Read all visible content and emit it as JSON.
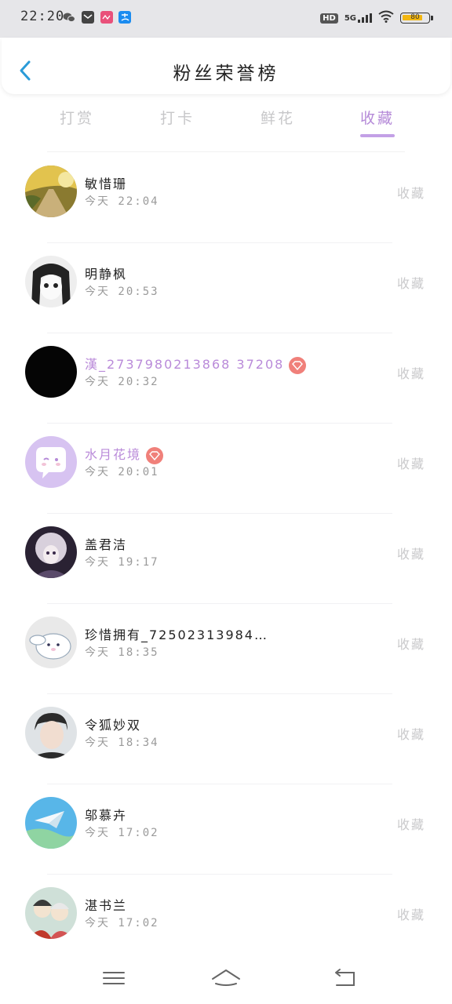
{
  "status_bar": {
    "time": "22:20",
    "network": "5G",
    "hd": "HD",
    "battery_level": "80",
    "battery_fraction": 0.8
  },
  "header": {
    "title": "粉丝荣誉榜",
    "back_icon": "chevron-left-icon"
  },
  "tabs": [
    {
      "label": "打赏",
      "active": false
    },
    {
      "label": "打卡",
      "active": false
    },
    {
      "label": "鲜花",
      "active": false
    },
    {
      "label": "收藏",
      "active": true
    }
  ],
  "colors": {
    "accent": "#b58ad8",
    "vip_name": "#b98ad9",
    "vip_badge": "#f0807a",
    "inactive": "#c7c7c9"
  },
  "fans": [
    {
      "name": "敏惜珊",
      "time": "今天 22:04",
      "action": "收藏",
      "vip": false
    },
    {
      "name": "明静枫",
      "time": "今天 20:53",
      "action": "收藏",
      "vip": false
    },
    {
      "name": "漢_2737980213868 37208",
      "time": "今天 20:32",
      "action": "收藏",
      "vip": true
    },
    {
      "name": "水月花境",
      "time": "今天 20:01",
      "action": "收藏",
      "vip": true
    },
    {
      "name": "盖君洁",
      "time": "今天 19:17",
      "action": "收藏",
      "vip": false
    },
    {
      "name": "珍惜拥有_72502313984…",
      "time": "今天 18:35",
      "action": "收藏",
      "vip": false
    },
    {
      "name": "令狐妙双",
      "time": "今天 18:34",
      "action": "收藏",
      "vip": false
    },
    {
      "name": "邬慕卉",
      "time": "今天 17:02",
      "action": "收藏",
      "vip": false
    },
    {
      "name": "湛书兰",
      "time": "今天 17:02",
      "action": "收藏",
      "vip": false
    }
  ],
  "nav_bar": {
    "menu_icon": "menu-icon",
    "home_icon": "home-icon",
    "back_icon": "back-icon"
  }
}
